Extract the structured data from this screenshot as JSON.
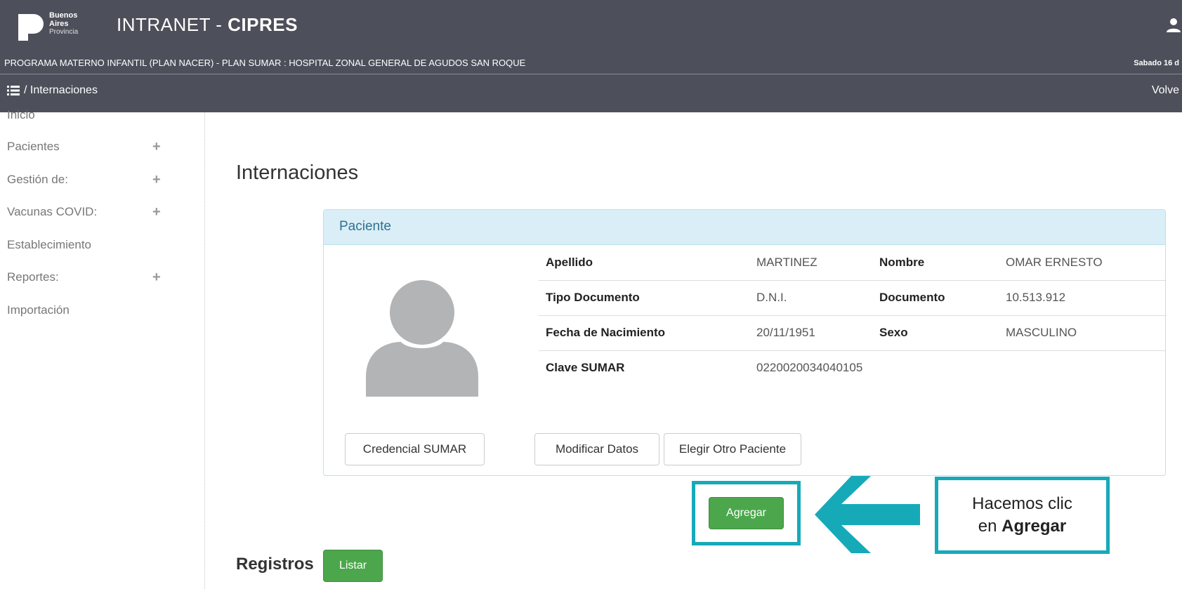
{
  "header": {
    "logo_lines": [
      "Buenos",
      "Aires",
      "Provincia"
    ],
    "title_prefix": "INTRANET - ",
    "title_strong": "CIPRES",
    "program": "PROGRAMA MATERNO INFANTIL (PLAN NACER) - PLAN SUMAR : HOSPITAL ZONAL GENERAL DE AGUDOS SAN ROQUE",
    "date": "Sabado 16 d",
    "breadcrumb": "/ Internaciones",
    "back_label": "Volve",
    "user_icon": "user-icon"
  },
  "sidebar": {
    "items": [
      {
        "label": "Inicio",
        "expandable": false
      },
      {
        "label": "Pacientes",
        "expandable": true
      },
      {
        "label": "Gestión de:",
        "expandable": true
      },
      {
        "label": "Vacunas COVID:",
        "expandable": true
      },
      {
        "label": "Establecimiento",
        "expandable": false
      },
      {
        "label": "Reportes:",
        "expandable": true
      },
      {
        "label": "Importación",
        "expandable": false
      }
    ],
    "plus_glyph": "+"
  },
  "main": {
    "title": "Internaciones",
    "panel": {
      "heading": "Paciente",
      "rows": [
        {
          "l1": "Apellido",
          "v1": "MARTINEZ",
          "l2": "Nombre",
          "v2": "OMAR ERNESTO"
        },
        {
          "l1": "Tipo Documento",
          "v1": "D.N.I.",
          "l2": "Documento",
          "v2": "10.513.912"
        },
        {
          "l1": "Fecha de Nacimiento",
          "v1": "20/11/1951",
          "l2": "Sexo",
          "v2": "MASCULINO"
        },
        {
          "l1": "Clave SUMAR",
          "v1": "0220020034040105",
          "l2": "",
          "v2": ""
        }
      ],
      "buttons": {
        "credencial": "Credencial SUMAR",
        "modificar": "Modificar Datos",
        "elegir_otro": "Elegir Otro Paciente"
      }
    },
    "agregar_label": "Agregar",
    "registros_label": "Registros",
    "listar_label": "Listar"
  },
  "annotation": {
    "line1": "Hacemos clic",
    "line2_prefix": "en ",
    "line2_bold": "Agregar",
    "accent_color": "#16aab9"
  },
  "colors": {
    "header_bg": "#4d4f5a",
    "panel_heading_bg": "#d9eef7",
    "button_green": "#4ca74c"
  }
}
